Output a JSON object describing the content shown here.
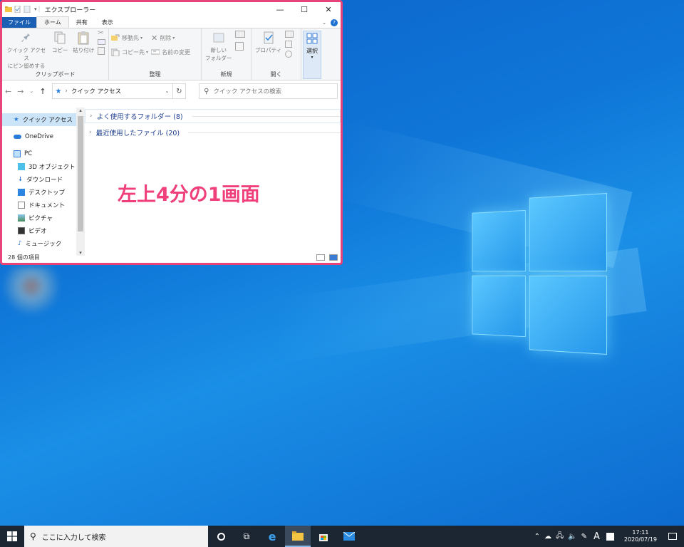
{
  "window": {
    "title": "エクスプローラー",
    "tabs": [
      "ファイル",
      "ホーム",
      "共有",
      "表示"
    ],
    "help": "?",
    "controls": {
      "minimize": "—",
      "maximize": "☐",
      "close": "✕"
    }
  },
  "ribbon": {
    "clipboard": {
      "pin_label_1": "クイック アクセス",
      "pin_label_2": "にピン留めする",
      "copy": "コピー",
      "paste": "貼り付け",
      "group": "クリップボード"
    },
    "organize": {
      "move": "移動先",
      "copyto": "コピー先",
      "delete": "削除",
      "rename": "名前の変更",
      "group": "整理"
    },
    "new": {
      "folder_1": "新しい",
      "folder_2": "フォルダー",
      "group": "新規"
    },
    "open": {
      "props": "プロパティ",
      "group": "開く"
    },
    "select": {
      "label": "選択"
    }
  },
  "address": {
    "path": "クイック アクセス",
    "search_placeholder": "クイック アクセスの検索"
  },
  "nav": {
    "items": [
      {
        "label": "クイック アクセス"
      },
      {
        "label": "OneDrive"
      },
      {
        "label": "PC"
      },
      {
        "label": "3D オブジェクト"
      },
      {
        "label": "ダウンロード"
      },
      {
        "label": "デスクトップ"
      },
      {
        "label": "ドキュメント"
      },
      {
        "label": "ピクチャ"
      },
      {
        "label": "ビデオ"
      },
      {
        "label": "ミュージック"
      }
    ]
  },
  "content": {
    "sections": [
      {
        "label": "よく使用するフォルダー (8)"
      },
      {
        "label": "最近使用したファイル (20)"
      }
    ]
  },
  "overlay_text": "左上4分の1画面",
  "status": {
    "count": "28 個の項目"
  },
  "taskbar": {
    "search_placeholder": "ここに入力して検索",
    "ime": "A",
    "time": "17:11",
    "date": "2020/07/19"
  },
  "colors": {
    "accent": "#e8447a",
    "file_tab": "#1a5fb4",
    "taskbar": "#1c2633"
  }
}
